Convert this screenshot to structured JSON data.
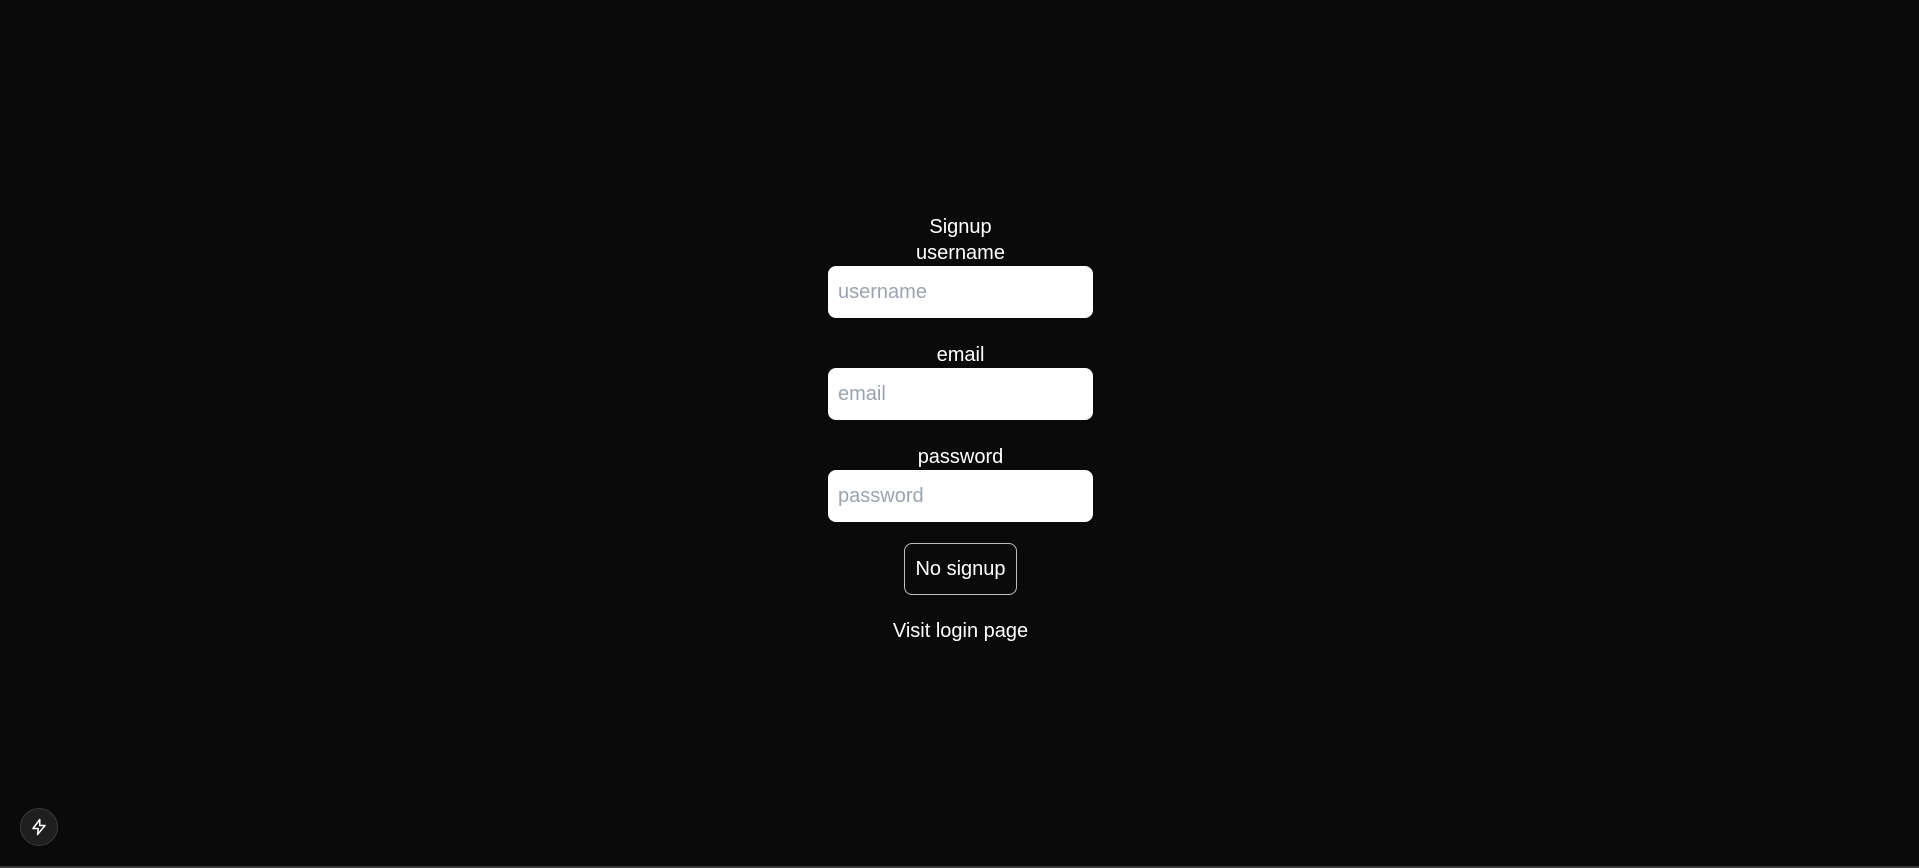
{
  "form": {
    "title": "Signup",
    "username": {
      "label": "username",
      "placeholder": "username",
      "value": ""
    },
    "email": {
      "label": "email",
      "placeholder": "email",
      "value": ""
    },
    "password": {
      "label": "password",
      "placeholder": "password",
      "value": ""
    },
    "submit_label": "No signup",
    "login_link": "Visit login page"
  },
  "dev_indicator": {
    "icon": "lightning-bolt-icon"
  },
  "colors": {
    "background": "#0a0a0a",
    "text": "#ffffff",
    "input_bg": "#ffffff",
    "placeholder": "#9ca3af",
    "button_border": "#bdbdbd"
  }
}
